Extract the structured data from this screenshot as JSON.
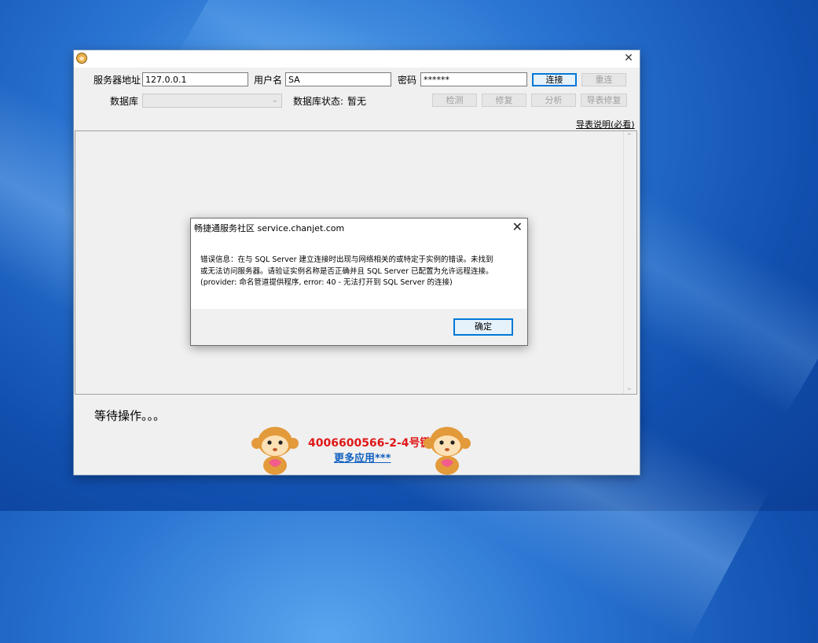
{
  "window": {
    "title": ""
  },
  "form": {
    "server_label": "服务器地址",
    "server_value": "127.0.0.1",
    "user_label": "用户名",
    "user_value": "SA",
    "password_label": "密码",
    "password_value": "******",
    "database_label": "数据库",
    "db_status_label": "数据库状态:",
    "db_status_value": "暂无"
  },
  "buttons": {
    "connect": "连接",
    "reconnect": "重连",
    "check": "检测",
    "repair": "修复",
    "analyze": "分析",
    "import_repair": "导表修复"
  },
  "links": {
    "import_help": "导表说明(必看)"
  },
  "footer": {
    "status": "等待操作。。。",
    "phone": "4006600566-2-4号键",
    "more_apps": "更多应用***"
  },
  "dialog": {
    "title": "畅捷通服务社区 service.chanjet.com",
    "message_lines": [
      "错误信息：在与 SQL Server 建立连接时出现与网络相关的或特定于实例的错误。未找到",
      "或无法访问服务器。请验证实例名称是否正确并且 SQL Server 已配置为允许远程连接。",
      "(provider: 命名管道提供程序, error: 40 - 无法打开到 SQL Server 的连接)"
    ],
    "ok_label": "确定"
  },
  "icons": {
    "app": "monkey-icon",
    "close": "close-icon",
    "combo_arrow": "chevron-down-icon",
    "scroll_up": "chevron-up-icon",
    "scroll_down": "chevron-down-icon"
  },
  "colors": {
    "phone": "#e01818",
    "link": "#1060c0",
    "default_button": "#0078d7"
  }
}
